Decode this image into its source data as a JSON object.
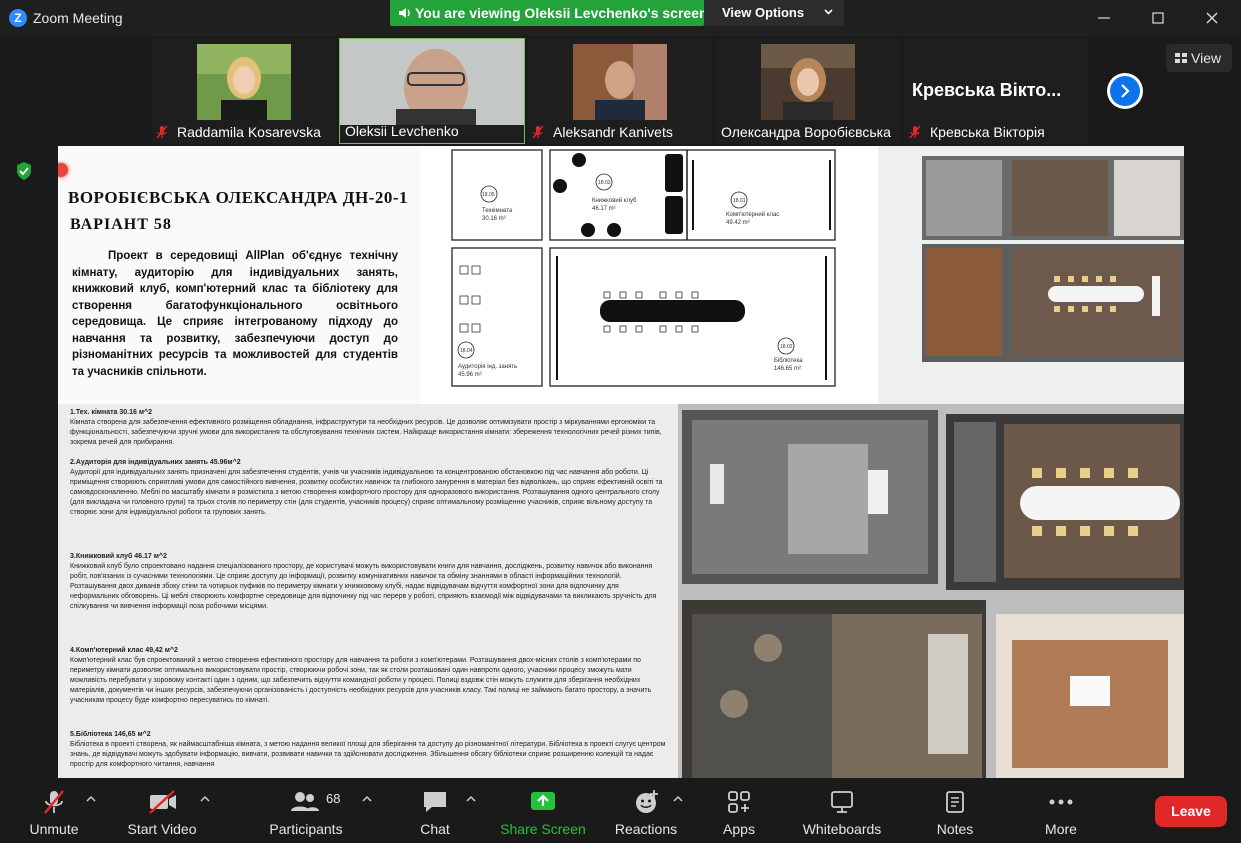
{
  "window": {
    "title": "Zoom Meeting",
    "logo_letter": "Z"
  },
  "share_banner": {
    "text": "You are viewing Oleksii Levchenko's screen",
    "view_options_label": "View Options"
  },
  "participants_strip": {
    "tiles": [
      {
        "name": "Raddamila Kosarevska",
        "muted": true
      },
      {
        "name": "Oleksii Levchenko",
        "muted": false,
        "active": true
      },
      {
        "name": "Aleksandr Kanivets",
        "muted": true
      },
      {
        "name": "Олександра Воробієвська",
        "muted": false
      },
      {
        "name": "Кревська Вікторія",
        "muted": true,
        "large_name": "Кревська Вікто..."
      }
    ],
    "view_label": "View"
  },
  "document": {
    "title": "ВОРОБІЄВСЬКА ОЛЕКСАНДРА ДН-20-1",
    "variant": "ВАРІАНТ 58",
    "intro": "Проект в середовищі AllPlan об'єднує технічну кімнату, аудиторію для індивідуальних занять, книжковий клуб, комп'ютерний клас та бібліотеку для створення багатофункціонального освітнього середовища. Це сприяє інтегрованому підходу до навчання та розвитку, забезпечуючи доступ до різноманітних ресурсів та можливостей для студентів та учасників спільноти.",
    "plan_rooms": [
      {
        "code": "18.05",
        "name": "Техкімната",
        "area": "30.16 m²"
      },
      {
        "code": "18.03",
        "name": "Книжковий клуб",
        "area": "46.17 m²"
      },
      {
        "code": "18.01",
        "name": "Комп'ютерний клас",
        "area": "49.42 m²"
      },
      {
        "code": "18.04",
        "name": "Аудиторія інд. занять",
        "area": "45.96 m²"
      },
      {
        "code": "18.02",
        "name": "Бібліотека",
        "area": "146.65 m²"
      }
    ],
    "sections": [
      {
        "heading": "1.Тех. кімната 30.16 м^2",
        "body": "Кімната створена для забезпечення ефективного розміщення обладнання, інфраструктури та необхідних ресурсів. Це дозволяє оптимізувати простір з міркуваннями ергономіки та функціональності, забезпечуючи зручні умови для використання та обслуговування технічних систем. Найкраще використання кімнати: збереження технологічних речей різних типів, зокрема речей для прибирання."
      },
      {
        "heading": "2.Аудиторія для індивідуальних занять 45.96м^2",
        "body": "Аудиторії для індивідуальних занять призначені для забезпечення студентів, учнів чи учасників індивідуальною та концентрованою обстановкою під час навчання або роботи. Ці приміщення створюють сприятливі умови для самостійного вивчення, розвитку особистих навичок та глибокого занурення в матеріал без відволікань, що сприяє ефективній освіті та самовдосконаленню. Меблі по масштабу кімнати я розмістила з метою створення комфортного простору для одноразового використання. Розташування одного центрального столу (для викладача чи головного групи) та трьох столів по периметру стін (для студентів, учасників процесу) сприяє оптимальному розміщенню учасників, сприяє вільному доступу та створює зони для індивідуальної роботи та групових занять."
      },
      {
        "heading": "3.Книжковий клуб 46.17 м^2",
        "body": "Книжковий клуб було спроектовано надання спеціалізованого простору, де користувачі можуть використовувати книги для навчання, досліджень, розвитку навичок або виконання робіт, пов'язаних із сучасними технологіями. Це сприяє доступу до інформації, розвитку комунікативних навичок та обміну знаннями в області інформаційних технологій. Розташування двох диванів збоку стіни та чотирьох пуфиків по периметру кімнати у книжковому клубі, надає відвідувачам відчуття комфортної зони для відпочинку для неформальних обговорень. Ці меблі створюють комфортне середовище для відпочинку під час перерв у роботі, сприяють взаємодії між відвідувачами та викликають зручність для спілкування чи вивчення інформації поза робочими місцями."
      },
      {
        "heading": "4.Комп'ютерний клас 49,42 м^2",
        "body": "Комп'ютерний клас був спроектований з метою створення ефективного простору для навчання та роботи з комп'ютерами. Розташування двох-місних столів з комп'ютерами по периметру кімнати дозволяє оптимально використовувати простір, створюючи робочі зони, так як столи розташовані один навпроти одного, учасники процесу зможуть мати можливість перебувати у зоровому контакті один з одним, що забезпечить відчуття командної роботи у процесі. Полиці вздовж стін можуть служити для зберігання необхідних матеріалів, документів чи інших ресурсів, забезпечуючи організованість і доступність необхідних ресурсів для учасників класу. Такі полиці не займають багато простору, а значить учасникам процесу буде комфортно пересуватись по кімнаті."
      },
      {
        "heading": "5.Бібліотека 146,65 м^2",
        "body": "Бібліотека в проекті створена, як наймасштабніша кімната, з метою надання великої площі для зберігання та доступу до різноманітної літератури. Бібліотека в проекті слугує центром знань, де відвідувачі можуть здобувати інформацію, вивчати, розвивати навички та здійснювати дослідження. Збільшення обсягу бібліотеки сприяє розширенню колекцій та надає простір для комфортного читання, навчання"
      }
    ]
  },
  "toolbar": {
    "items": [
      {
        "label": "Unmute",
        "icon": "mic-muted-icon"
      },
      {
        "label": "Start Video",
        "icon": "video-off-icon"
      },
      {
        "label": "Participants",
        "icon": "participants-icon",
        "count": "68"
      },
      {
        "label": "Chat",
        "icon": "chat-icon"
      },
      {
        "label": "Share Screen",
        "icon": "share-screen-icon"
      },
      {
        "label": "Reactions",
        "icon": "reactions-icon"
      },
      {
        "label": "Apps",
        "icon": "apps-icon"
      },
      {
        "label": "Whiteboards",
        "icon": "whiteboard-icon"
      },
      {
        "label": "Notes",
        "icon": "notes-icon"
      },
      {
        "label": "More",
        "icon": "more-icon"
      }
    ],
    "leave_label": "Leave"
  },
  "colors": {
    "share_green": "#23a33a",
    "leave_red": "#e02828",
    "accent_blue": "#0e72ed",
    "active_border": "#7bbd55"
  }
}
